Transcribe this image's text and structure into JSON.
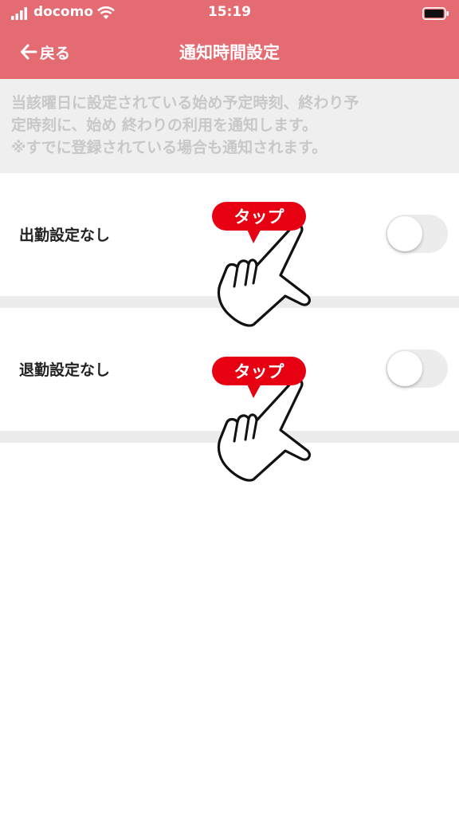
{
  "status_bar": {
    "carrier": "docomo",
    "time": "15:19",
    "icons": [
      "signal-icon",
      "wifi-icon",
      "battery-icon"
    ]
  },
  "nav": {
    "back_label": "戻る",
    "title": "通知時間設定"
  },
  "info": {
    "lines": [
      "当該曜日に設定されている始め予定時刻、終わり予",
      "定時刻に、始め 終わりの利用を通知します。",
      "※すでに登録されている場合も通知されます。"
    ]
  },
  "settings": [
    {
      "label": "出勤設定なし",
      "enabled": false
    },
    {
      "label": "退勤設定なし",
      "enabled": false
    }
  ],
  "tap_hint": {
    "label": "タップ"
  },
  "colors": {
    "header": "#e56b73",
    "info_background": "#efefef",
    "info_text": "#c8c8c8",
    "tap_badge": "#e60012",
    "toggle_off": "#ececec"
  }
}
